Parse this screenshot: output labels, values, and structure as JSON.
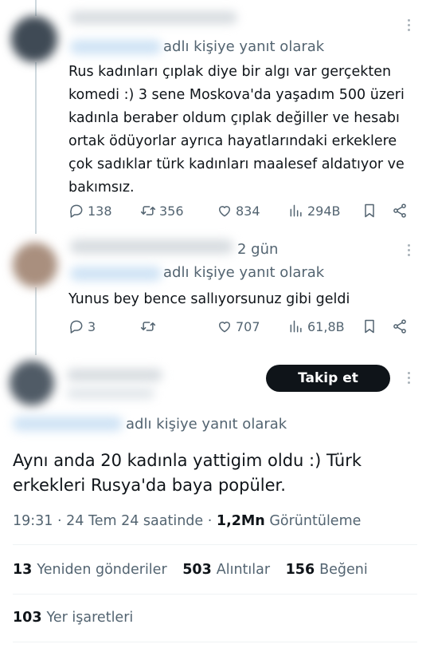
{
  "reply1": {
    "reply_to_text": "adlı kişiye yanıt olarak",
    "body": "Rus kadınları çıplak diye bir algı var gerçekten komedi :)  3 sene Moskova'da yaşadım 500 üzeri kadınla beraber oldum çıplak değiller ve hesabı ortak ödüyorlar ayrıca hayatlarındaki erkeklere çok sadıklar türk kadınları maalesef aldatıyor ve bakımsız.",
    "replies": "138",
    "reposts": "356",
    "likes": "834",
    "views": "294B"
  },
  "reply2": {
    "time": "2 gün",
    "reply_to_text": "adlı kişiye yanıt olarak",
    "body": "Yunus bey bence sallıyorsunuz gibi geldi",
    "replies": "3",
    "reposts": "",
    "likes": "707",
    "views": "61,8B"
  },
  "main_post": {
    "follow_label": "Takip et",
    "reply_to_text": "adlı kişiye yanıt olarak",
    "body": "Aynı anda 20 kadınla yattigim oldu :) Türk erkekleri Rusya'da baya popüler.",
    "time": "19:31",
    "date": "24 Tem 24 saatinde",
    "views_count": "1,2Mn",
    "views_label": "Görüntüleme",
    "reposts_count": "13",
    "reposts_label": "Yeniden gönderiler",
    "quotes_count": "503",
    "quotes_label": "Alıntılar",
    "likes_count": "156",
    "likes_label": "Beğeni",
    "bookmarks_count": "103",
    "bookmarks_label": "Yer işaretleri"
  },
  "icons": [
    "reply-icon",
    "repost-icon",
    "like-icon",
    "views-icon",
    "bookmark-icon",
    "share-icon",
    "more-icon"
  ],
  "colors": {
    "text": "#0f1419",
    "secondary": "#536471",
    "follow_bg": "#0f1419",
    "divider": "#eff3f4"
  }
}
